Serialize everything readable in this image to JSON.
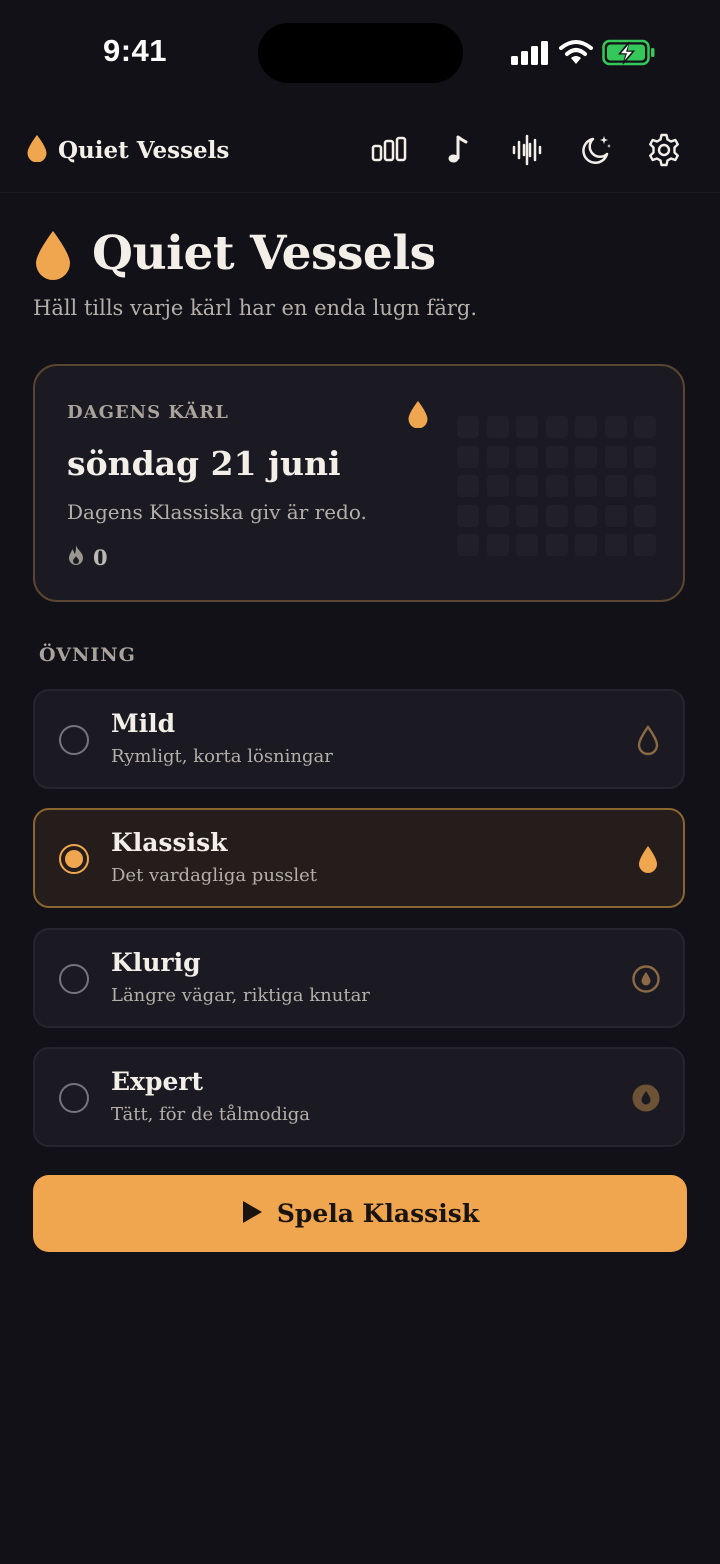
{
  "status_bar": {
    "time": "9:41"
  },
  "nav": {
    "brand": "Quiet Vessels",
    "icons": [
      "stats-icon",
      "music-icon",
      "sound-icon",
      "theme-icon",
      "settings-icon"
    ]
  },
  "hero": {
    "title": "Quiet Vessels",
    "subtitle": "Häll tills varje kärl har en enda lugn färg."
  },
  "daily": {
    "eyebrow": "DAGENS KÄRL",
    "date": "söndag 21 juni",
    "description": "Dagens Klassiska giv är redo.",
    "streak": "0"
  },
  "practice": {
    "label": "ÖVNING",
    "options": [
      {
        "title": "Mild",
        "subtitle": "Rymligt, korta lösningar",
        "selected": false
      },
      {
        "title": "Klassisk",
        "subtitle": "Det vardagliga pusslet",
        "selected": true
      },
      {
        "title": "Klurig",
        "subtitle": "Längre vägar, riktiga knutar",
        "selected": false
      },
      {
        "title": "Expert",
        "subtitle": "Tätt, för de tålmodiga",
        "selected": false
      }
    ]
  },
  "play_button": {
    "label": "Spela Klassisk"
  },
  "colors": {
    "background": "#131118",
    "accent": "#f0a64e",
    "card": "#1b1a22",
    "card_border": "#5a4530",
    "battery": "#34c759"
  }
}
